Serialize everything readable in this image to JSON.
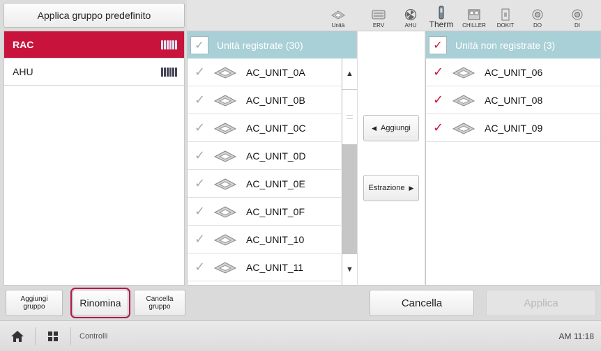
{
  "header": {
    "preset_button": "Applica gruppo predefinito",
    "filters": [
      {
        "label": "Unità",
        "icon": "cassette-icon"
      },
      {
        "label": "ERV",
        "icon": "erv-icon"
      },
      {
        "label": "AHU",
        "icon": "fan-icon"
      },
      {
        "label": "Therm",
        "icon": "thermometer-icon"
      },
      {
        "label": "CHILLER",
        "icon": "chiller-icon"
      },
      {
        "label": "DOKIT",
        "icon": "dokit-icon"
      },
      {
        "label": "DO",
        "icon": "do-icon"
      },
      {
        "label": "DI",
        "icon": "di-icon"
      }
    ]
  },
  "groups": [
    {
      "name": "RAC",
      "selected": true
    },
    {
      "name": "AHU",
      "selected": false
    }
  ],
  "registered": {
    "title": "Unità registrate (30)",
    "units": [
      "AC_UNIT_0A",
      "AC_UNIT_0B",
      "AC_UNIT_0C",
      "AC_UNIT_0D",
      "AC_UNIT_0E",
      "AC_UNIT_0F",
      "AC_UNIT_10",
      "AC_UNIT_11"
    ]
  },
  "transfer": {
    "add_label": "Aggiungi",
    "extract_label": "Estrazione"
  },
  "unregistered": {
    "title": "Unità non registrate (3)",
    "units": [
      "AC_UNIT_06",
      "AC_UNIT_08",
      "AC_UNIT_09"
    ]
  },
  "actions": {
    "add_group": "Aggiungi gruppo",
    "rename": "Rinomina",
    "delete_group": "Cancella gruppo",
    "cancel": "Cancella",
    "apply": "Applica"
  },
  "status_bar": {
    "section": "Controlli",
    "clock": "AM 11:18"
  },
  "colors": {
    "accent": "#c8143c",
    "panel_header": "#a9cfd7"
  }
}
